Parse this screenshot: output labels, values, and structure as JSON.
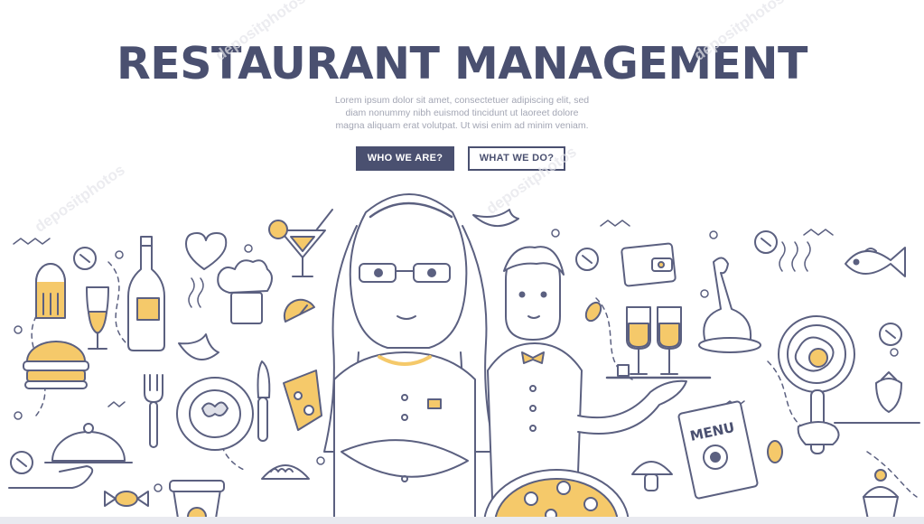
{
  "hero": {
    "title": "RESTAURANT MANAGEMENT",
    "lorem_lines": [
      "Lorem ipsum dolor sit amet, consectetuer adipiscing elit, sed",
      "diam nonummy nibh euismod tincidunt ut laoreet dolore",
      "magna aliquam erat volutpat. Ut wisi enim ad minim veniam."
    ],
    "buttons": {
      "primary_label": "WHO WE ARE?",
      "secondary_label": "WHAT WE DO?"
    }
  },
  "illustration": {
    "menu_card_text": "MENU",
    "icons": [
      "salt-shaker-icon",
      "burger-icon",
      "cloche-icon",
      "wine-glass-icon",
      "wine-bottle-icon",
      "heart-icon",
      "chef-hat-icon",
      "cocktail-icon",
      "lemon-slice-icon",
      "croissant-icon",
      "fork-icon",
      "plate-icon",
      "knife-icon",
      "cheese-icon",
      "candy-icon",
      "coffee-cup-icon",
      "dumpling-icon",
      "manager-woman-figure",
      "waiter-figure",
      "champagne-tray-icon",
      "wallet-icon",
      "chicken-leg-icon",
      "fish-icon",
      "frying-pan-icon",
      "strawberry-icon",
      "menu-card-icon",
      "pizza-icon",
      "mushroom-icon",
      "cupcake-icon"
    ]
  },
  "colors": {
    "navy": "#4a5070",
    "accent_yellow": "#f5c96a",
    "muted_text": "#a3a6b4",
    "line": "#5b6080",
    "shade": "#dfe0e8"
  },
  "watermark": "depositphotos"
}
